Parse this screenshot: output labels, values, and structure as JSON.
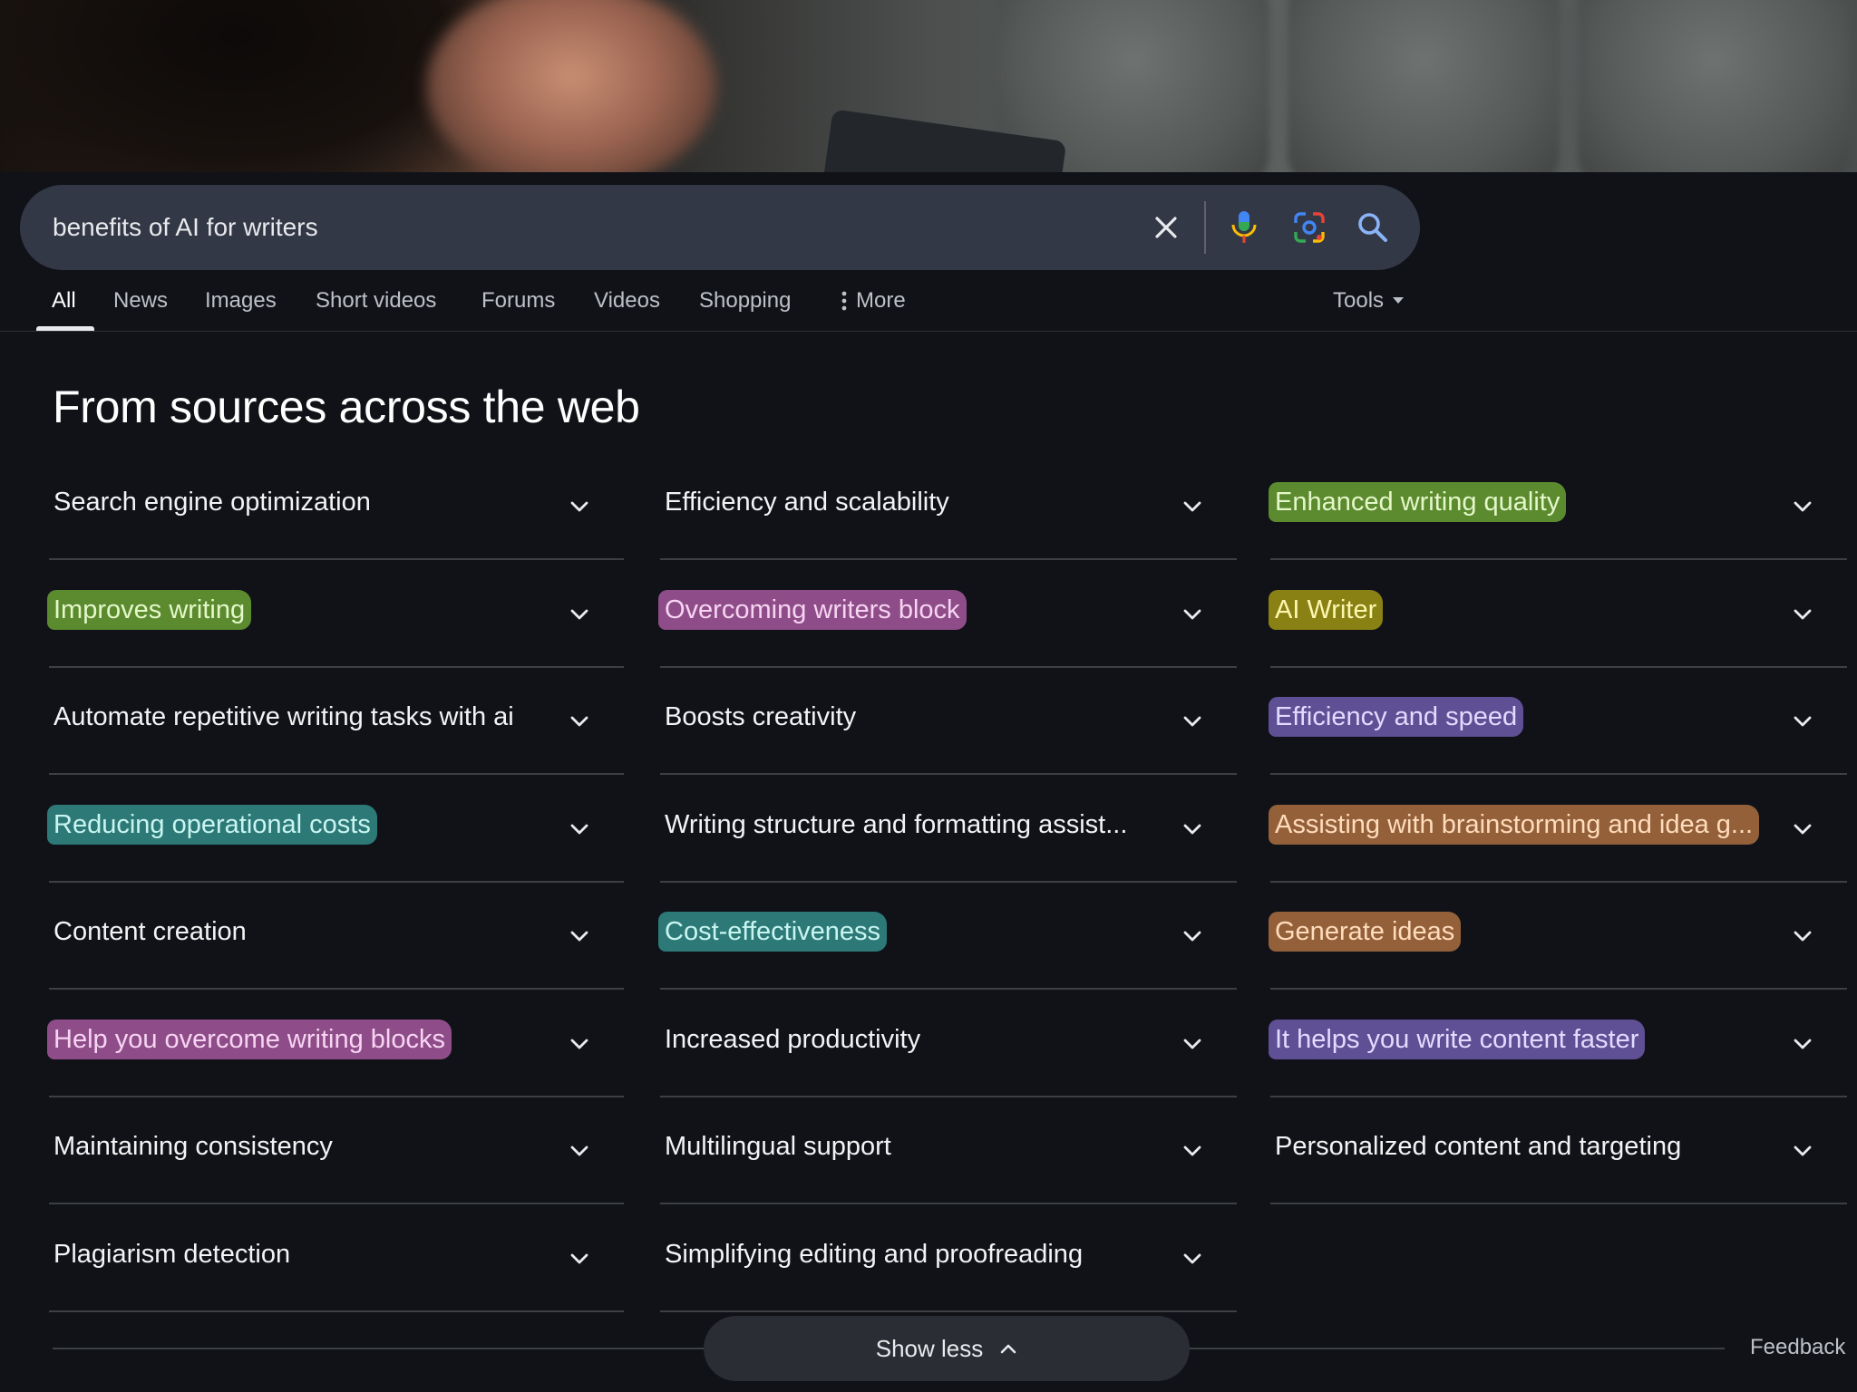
{
  "search": {
    "query": "benefits of AI for writers"
  },
  "tabs": [
    {
      "label": "All",
      "active": true
    },
    {
      "label": "News"
    },
    {
      "label": "Images"
    },
    {
      "label": "Short videos"
    },
    {
      "label": "Forums"
    },
    {
      "label": "Videos"
    },
    {
      "label": "Shopping"
    },
    {
      "label": "More"
    }
  ],
  "tools_label": "Tools",
  "heading": "From sources across the web",
  "columns": [
    [
      {
        "label": "Search engine optimization"
      },
      {
        "label": "Improves writing",
        "highlight": "green"
      },
      {
        "label": "Automate repetitive writing tasks with ai"
      },
      {
        "label": "Reducing operational costs",
        "highlight": "teal"
      },
      {
        "label": "Content creation"
      },
      {
        "label": "Help you overcome writing blocks",
        "highlight": "pink"
      },
      {
        "label": "Maintaining consistency"
      },
      {
        "label": "Plagiarism detection"
      }
    ],
    [
      {
        "label": "Efficiency and scalability"
      },
      {
        "label": "Overcoming writers block",
        "highlight": "pink"
      },
      {
        "label": "Boosts creativity"
      },
      {
        "label": "Writing structure and formatting assist..."
      },
      {
        "label": "Cost-effectiveness",
        "highlight": "teal"
      },
      {
        "label": "Increased productivity"
      },
      {
        "label": "Multilingual support"
      },
      {
        "label": "Simplifying editing and proofreading"
      }
    ],
    [
      {
        "label": "Enhanced writing quality",
        "highlight": "green"
      },
      {
        "label": "AI Writer",
        "highlight": "yellow"
      },
      {
        "label": "Efficiency and speed",
        "highlight": "purple"
      },
      {
        "label": "Assisting with brainstorming and idea g...",
        "highlight": "orange"
      },
      {
        "label": "Generate ideas",
        "highlight": "orange"
      },
      {
        "label": "It helps you write content faster",
        "highlight": "purple"
      },
      {
        "label": "Personalized content and targeting"
      }
    ]
  ],
  "show_less_label": "Show less",
  "feedback_label": "Feedback",
  "icons": {
    "clear": "close-icon",
    "voice": "microphone-icon",
    "lens": "camera-lens-icon",
    "search": "search-icon",
    "more": "vertical-dots-icon",
    "tools": "caret-down-icon",
    "expand": "chevron-down-icon",
    "collapse": "chevron-up-icon"
  },
  "colors": {
    "background": "#101218",
    "searchbox": "#333846",
    "highlight_green": "#5b8a2f",
    "highlight_pink": "#8e4d88",
    "highlight_yellow": "#8a8114",
    "highlight_purple": "#5f4f95",
    "highlight_teal": "#2d7977",
    "highlight_orange": "#93603a"
  }
}
